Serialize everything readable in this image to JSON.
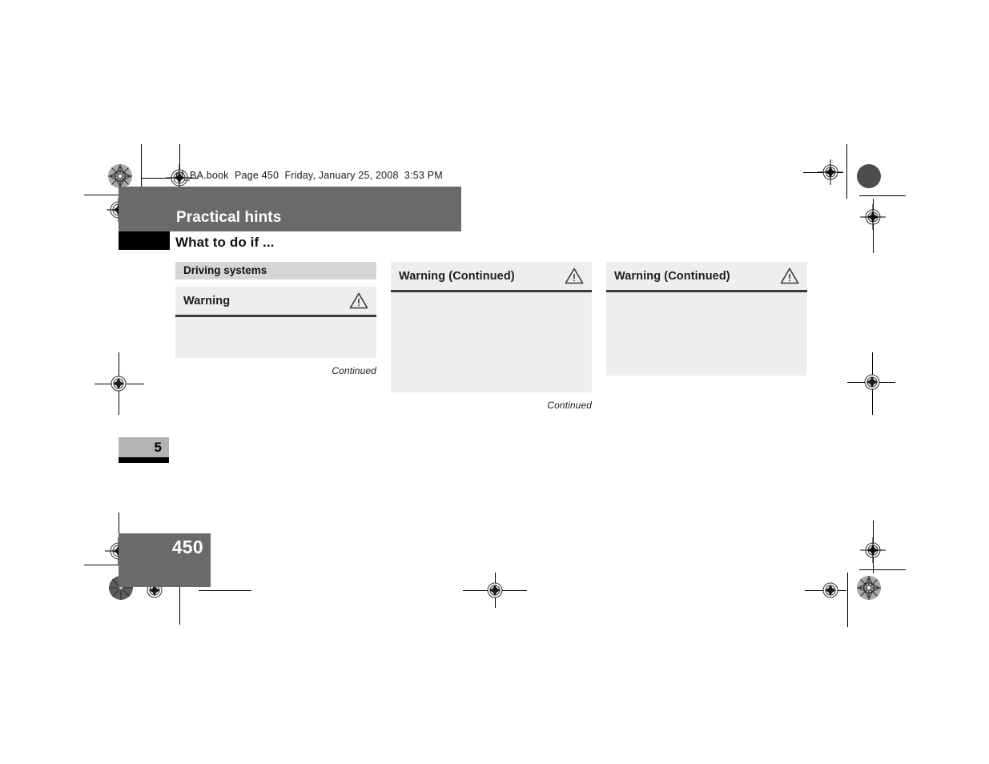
{
  "book_header": {
    "text": "nf_BA.book  Page 450  Friday, January 25, 2008  3:53 PM"
  },
  "chapter_banner": {
    "title": "Practical hints"
  },
  "section": {
    "title": "What to do if ..."
  },
  "columns": [
    {
      "group_heading": "Driving systems",
      "boxes": [
        {
          "title": "Warning",
          "icon": "warning-triangle-icon",
          "body": ""
        }
      ],
      "continued_label": "Continued"
    },
    {
      "group_heading": null,
      "boxes": [
        {
          "title": "Warning (Continued)",
          "icon": "warning-triangle-icon",
          "body": ""
        }
      ],
      "continued_label": "Continued"
    },
    {
      "group_heading": null,
      "boxes": [
        {
          "title": "Warning (Continued)",
          "icon": "warning-triangle-icon",
          "body": ""
        }
      ],
      "continued_label": null
    }
  ],
  "thumb_index": {
    "chapter_number": "5"
  },
  "folio": {
    "page_number": "450"
  },
  "colors": {
    "banner_gray": "#6a6a6a",
    "group_head_gray": "#d6d6d6",
    "warnbox_gray": "#eeeeee",
    "rule_dark": "#3a3a3a",
    "thumb_gray": "#b3b3b3",
    "black": "#000000",
    "white": "#ffffff"
  }
}
